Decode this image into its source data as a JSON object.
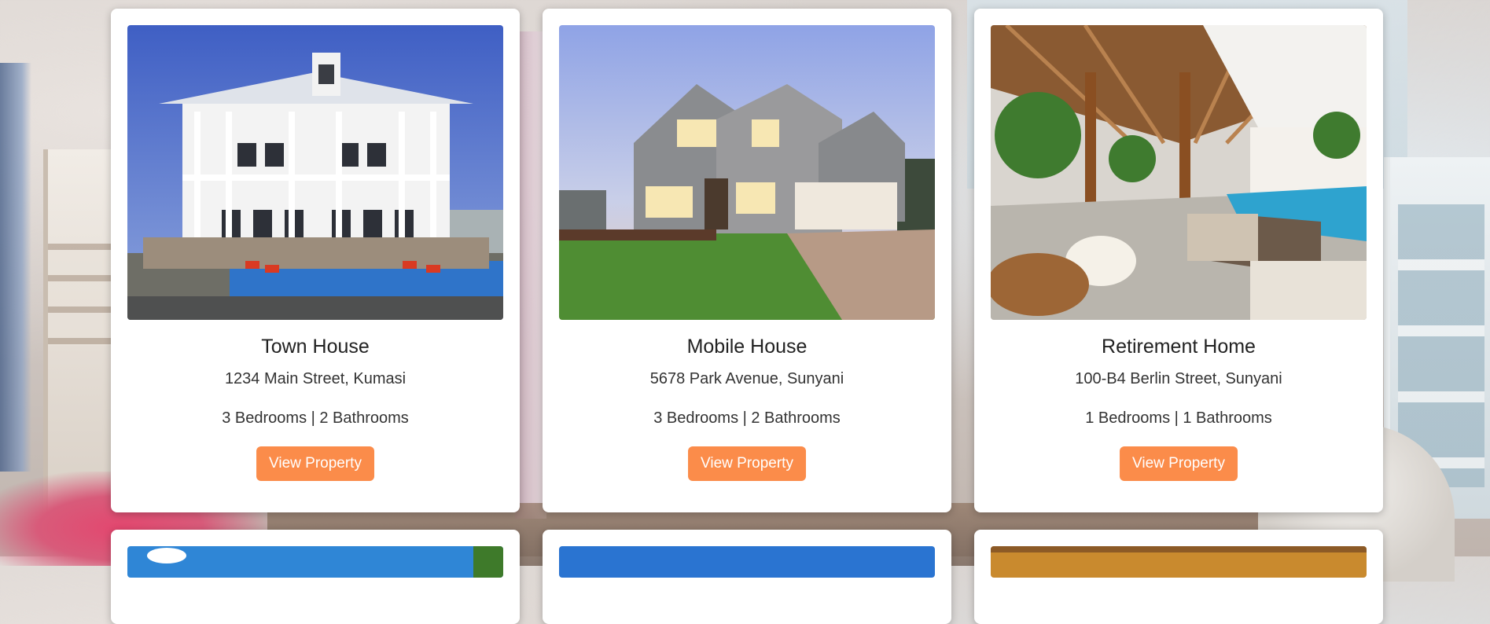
{
  "listings": [
    {
      "title": "Town House",
      "address": "1234 Main Street, Kumasi",
      "rooms": "3 Bedrooms | 2 Bathrooms",
      "button_label": "View Property",
      "image_desc": "white two-story house with porches and pool"
    },
    {
      "title": "Mobile House",
      "address": "5678 Park Avenue, Sunyani",
      "rooms": "3 Bedrooms | 2 Bathrooms",
      "button_label": "View Property",
      "image_desc": "grey suburban house with lawn and garage at dusk"
    },
    {
      "title": "Retirement Home",
      "address": "100-B4 Berlin Street, Sunyani",
      "rooms": "1 Bedrooms | 1 Bathrooms",
      "button_label": "View Property",
      "image_desc": "tropical villa patio with pool and lounge"
    }
  ],
  "colors": {
    "button": "#fb8c4a",
    "card": "#ffffff",
    "text": "#222222"
  }
}
